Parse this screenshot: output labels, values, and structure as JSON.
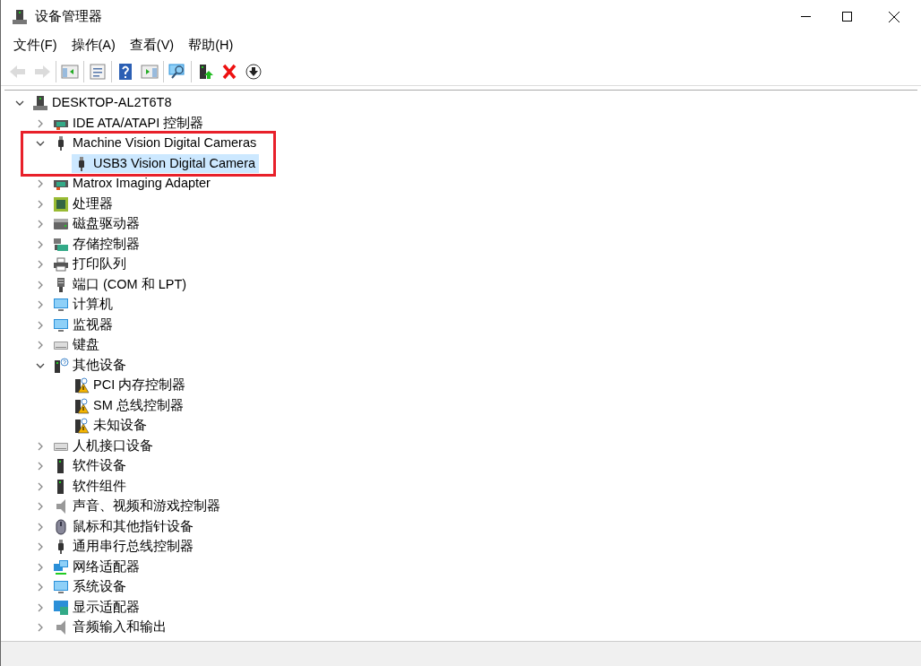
{
  "window": {
    "title": "设备管理器"
  },
  "menu": [
    "文件(F)",
    "操作(A)",
    "查看(V)",
    "帮助(H)"
  ],
  "toolbar": [
    [
      {
        "kind": "back",
        "disabled": true
      },
      {
        "kind": "forward",
        "disabled": true
      }
    ],
    [
      {
        "kind": "tree",
        "disabled": false
      }
    ],
    [
      {
        "kind": "properties",
        "disabled": false
      }
    ],
    [
      {
        "kind": "help",
        "disabled": false
      },
      {
        "kind": "pane",
        "disabled": false
      }
    ],
    [
      {
        "kind": "scan",
        "disabled": false
      }
    ],
    [
      {
        "kind": "update",
        "disabled": false
      },
      {
        "kind": "uninstall",
        "disabled": false
      },
      {
        "kind": "disable",
        "disabled": false
      }
    ]
  ],
  "tree": [
    {
      "label": "DESKTOP-AL2T6T8",
      "kind": "computer",
      "expanded": true,
      "selected": false,
      "children": [
        {
          "label": "IDE ATA/ATAPI 控制器",
          "kind": "card",
          "expanded": false,
          "selected": false
        },
        {
          "label": "Machine Vision Digital Cameras",
          "kind": "usb",
          "expanded": true,
          "selected": false,
          "highlighted": true,
          "children": [
            {
              "label": "USB3 Vision Digital Camera",
              "kind": "usb",
              "selected": true
            }
          ]
        },
        {
          "label": "Matrox Imaging Adapter",
          "kind": "card",
          "expanded": false,
          "selected": false
        },
        {
          "label": "处理器",
          "kind": "chip",
          "expanded": false,
          "selected": false
        },
        {
          "label": "磁盘驱动器",
          "kind": "disk",
          "expanded": false,
          "selected": false
        },
        {
          "label": "存储控制器",
          "kind": "storage",
          "expanded": false,
          "selected": false
        },
        {
          "label": "打印队列",
          "kind": "printer",
          "expanded": false,
          "selected": false
        },
        {
          "label": "端口 (COM 和 LPT)",
          "kind": "port",
          "expanded": false,
          "selected": false
        },
        {
          "label": "计算机",
          "kind": "monitor",
          "expanded": false,
          "selected": false
        },
        {
          "label": "监视器",
          "kind": "monitor",
          "expanded": false,
          "selected": false
        },
        {
          "label": "键盘",
          "kind": "keyboard",
          "expanded": false,
          "selected": false
        },
        {
          "label": "其他设备",
          "kind": "unknown",
          "expanded": true,
          "selected": false,
          "children": [
            {
              "label": "PCI 内存控制器",
              "kind": "warning",
              "selected": false
            },
            {
              "label": "SM 总线控制器",
              "kind": "warning",
              "selected": false
            },
            {
              "label": "未知设备",
              "kind": "warning",
              "selected": false
            }
          ]
        },
        {
          "label": "人机接口设备",
          "kind": "keyboard",
          "expanded": false,
          "selected": false
        },
        {
          "label": "软件设备",
          "kind": "device",
          "expanded": false,
          "selected": false
        },
        {
          "label": "软件组件",
          "kind": "device",
          "expanded": false,
          "selected": false
        },
        {
          "label": "声音、视频和游戏控制器",
          "kind": "speaker",
          "expanded": false,
          "selected": false
        },
        {
          "label": "鼠标和其他指针设备",
          "kind": "mouse",
          "expanded": false,
          "selected": false
        },
        {
          "label": "通用串行总线控制器",
          "kind": "usb",
          "expanded": false,
          "selected": false
        },
        {
          "label": "网络适配器",
          "kind": "network",
          "expanded": false,
          "selected": false
        },
        {
          "label": "系统设备",
          "kind": "monitor",
          "expanded": false,
          "selected": false
        },
        {
          "label": "显示适配器",
          "kind": "display",
          "expanded": false,
          "selected": false
        },
        {
          "label": "音频输入和输出",
          "kind": "speaker",
          "expanded": false,
          "selected": false
        }
      ]
    }
  ]
}
